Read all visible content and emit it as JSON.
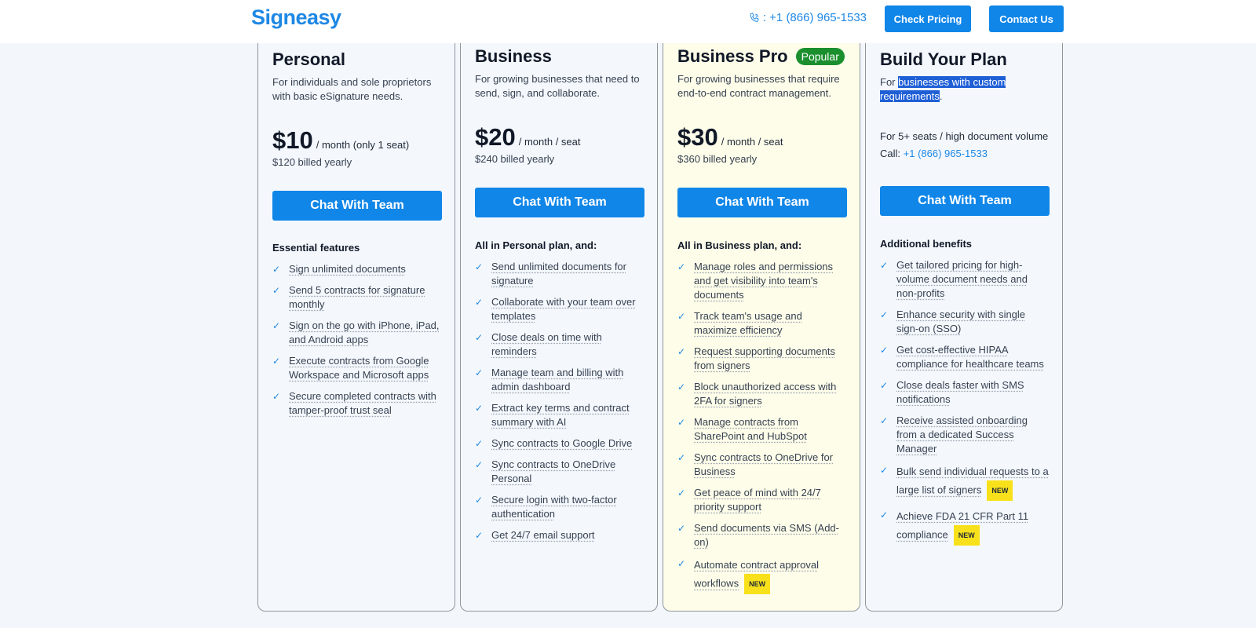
{
  "header": {
    "logo": "Signeasy",
    "phone_prefix": ":",
    "phone": "+1 (866) 965-1533",
    "check_pricing": "Check Pricing",
    "contact_us": "Contact Us"
  },
  "colors": {
    "primary": "#1086e8",
    "popular_badge": "#1b8f2e",
    "new_badge": "#f8e11b",
    "highlight_card": "#fdfde9"
  },
  "plans": [
    {
      "name": "Personal",
      "desc": "For individuals and sole proprietors with basic eSignature needs.",
      "price": "$10",
      "unit": "/ month (only 1 seat)",
      "billed": "$120 billed yearly",
      "cta": "Chat With Team",
      "features_title": "Essential features",
      "features": [
        "Sign unlimited documents",
        "Send 5 contracts for signature monthly",
        "Sign on the go with iPhone, iPad, and Android apps",
        "Execute contracts from Google Workspace and Microsoft apps",
        "Secure completed contracts with tamper-proof trust seal"
      ]
    },
    {
      "name": "Business",
      "desc": "For growing businesses that need to send, sign, and collaborate.",
      "price": "$20",
      "unit": "/ month / seat",
      "billed": "$240 billed yearly",
      "cta": "Chat With Team",
      "features_title": "All in Personal plan, and:",
      "features": [
        "Send unlimited documents for signature",
        "Collaborate with your team over templates",
        "Close deals on time with reminders",
        "Manage team and billing with admin dashboard",
        "Extract key terms and contract summary with AI",
        "Sync contracts to Google Drive",
        "Sync contracts to OneDrive Personal",
        "Secure login with two-factor authentication",
        "Get 24/7 email support"
      ]
    },
    {
      "name": "Business Pro",
      "badge": "Popular",
      "desc": "For growing businesses that require end-to-end contract management.",
      "price": "$30",
      "unit": "/ month / seat",
      "billed": "$360 billed yearly",
      "cta": "Chat With Team",
      "features_title": "All in Business plan, and:",
      "features": [
        "Manage roles and permissions and get visibility into team's documents",
        "Track team's usage and maximize efficiency",
        "Request supporting documents from signers",
        "Block unauthorized access with 2FA for signers",
        "Manage contracts from SharePoint and HubSpot",
        "Sync contracts to OneDrive for Business",
        "Get peace of mind with 24/7 priority support",
        "Send documents via SMS (Add-on)",
        "Automate contract approval workflows"
      ],
      "new_label": "NEW"
    },
    {
      "name": "Build Your Plan",
      "desc_prefix": "For ",
      "desc_highlight": "businesses with custom requirements",
      "desc_suffix": ".",
      "seats_info": "For 5+ seats / high document volume",
      "call_label": "Call:",
      "call_phone": "+1 (866) 965-1533",
      "cta": "Chat With Team",
      "features_title": "Additional benefits",
      "features": [
        "Get tailored pricing for high-volume document needs and non-profits",
        "Enhance security with single sign-on (SSO)",
        "Get cost-effective HIPAA compliance for healthcare teams",
        "Close deals faster with SMS notifications",
        "Receive assisted onboarding from a dedicated Success Manager",
        "Bulk send individual requests to a large list of signers",
        "Achieve FDA 21 CFR Part 11 compliance"
      ],
      "new_label": "NEW"
    }
  ]
}
